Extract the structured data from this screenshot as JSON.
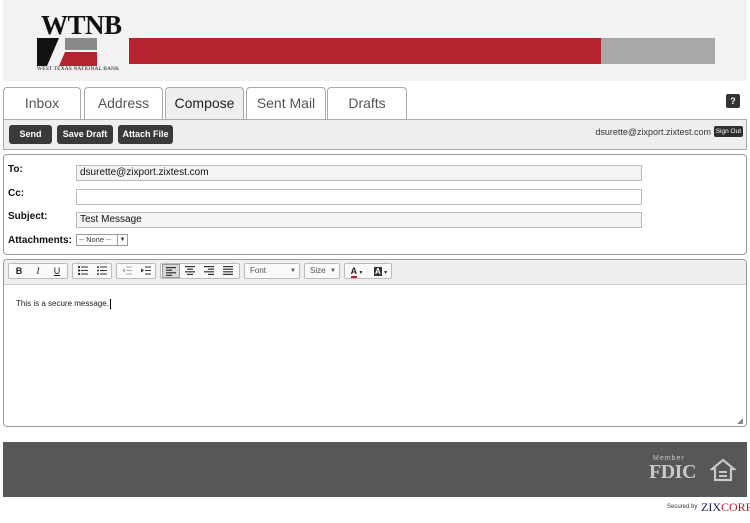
{
  "brand": {
    "logo": "WTNB",
    "bank_name": "WEST TEXAS NATIONAL BANK",
    "accent_red": "#b52230",
    "accent_gray": "#a8a8a8"
  },
  "tabs": [
    {
      "label": "Inbox",
      "active": false
    },
    {
      "label": "Address",
      "active": false
    },
    {
      "label": "Compose",
      "active": true
    },
    {
      "label": "Sent Mail",
      "active": false
    },
    {
      "label": "Drafts",
      "active": false
    }
  ],
  "help_label": "?",
  "toolbar": {
    "send": "Send",
    "save_draft": "Save Draft",
    "attach_file": "Attach File",
    "user_email": "dsurette@zixport.zixtest.com",
    "sign_out": "Sign Out"
  },
  "form": {
    "to_label": "To:",
    "to_value": "dsurette@zixport.zixtest.com",
    "cc_label": "Cc:",
    "cc_value": "",
    "subject_label": "Subject:",
    "subject_value": "Test Message",
    "attachments_label": "Attachments:",
    "attachments_selected": "-- None --"
  },
  "editor": {
    "bold": "B",
    "italic": "I",
    "underline": "U",
    "font_label": "Font",
    "size_label": "Size",
    "text_color": "A",
    "bg_color": "A",
    "body": "This is a secure message."
  },
  "footer": {
    "fdic_member": "Member",
    "fdic": "FDIC",
    "secured_by": "Secured by",
    "zix_a": "ZIX",
    "zix_b": "CORP"
  }
}
